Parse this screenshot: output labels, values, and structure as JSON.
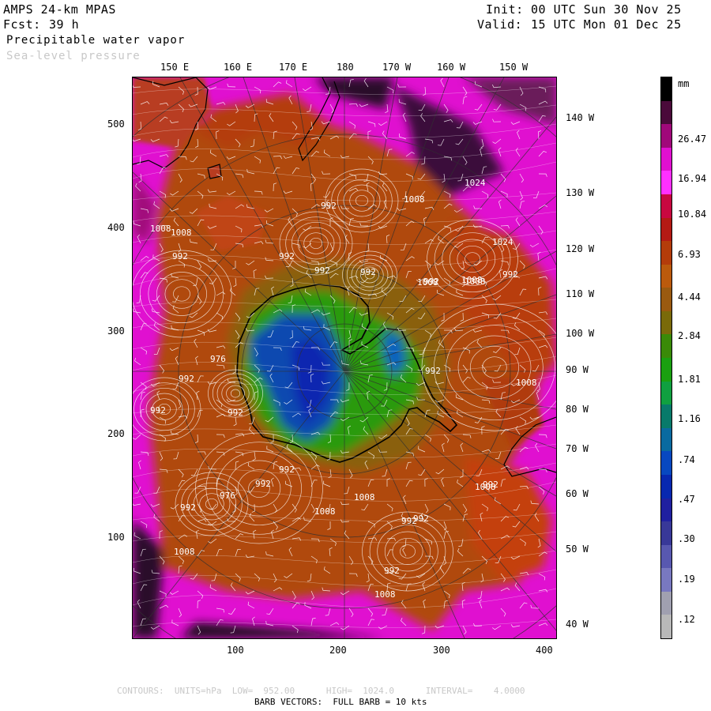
{
  "header": {
    "model": "AMPS 24-km MPAS",
    "fcst_label": "Fcst:",
    "fcst_hours": "39 h",
    "field1": "Precipitable water vapor",
    "field2": "Sea-level pressure",
    "init_label": "Init:",
    "init_time": "00 UTC Sun 30 Nov 25",
    "valid_label": "Valid:",
    "valid_time": "15 UTC Mon 01 Dec 25"
  },
  "top_longitudes": [
    "150 E",
    "160 E",
    "170 E",
    "180",
    "170 W",
    "160 W",
    "150 W"
  ],
  "right_longitudes": [
    "140 W",
    "130 W",
    "120 W",
    "110 W",
    "100 W",
    "90 W",
    "80 W",
    "70 W",
    "60 W",
    "50 W",
    "40 W"
  ],
  "y_axis_ticks": [
    "500",
    "400",
    "300",
    "200",
    "100"
  ],
  "x_axis_ticks": [
    "100",
    "200",
    "300",
    "400"
  ],
  "colorbar": {
    "unit": "mm",
    "labels": [
      "26.47",
      "16.94",
      "10.84",
      "6.93",
      "4.44",
      "2.84",
      "1.81",
      "1.16",
      ".74",
      ".47",
      ".30",
      ".19",
      ".12"
    ],
    "colors": [
      "#000000",
      "#4a0a3a",
      "#a0087a",
      "#e010d0",
      "#ff30ff",
      "#c80840",
      "#b41a14",
      "#b43c0a",
      "#bb5a0c",
      "#9a5a10",
      "#7a6a0a",
      "#3a8a08",
      "#1aa010",
      "#10a040",
      "#087a6a",
      "#0a6aa0",
      "#0848c0",
      "#0828b0",
      "#2020a0",
      "#383898",
      "#5858b0",
      "#7878c0",
      "#a0a0b0",
      "#b8b8b8"
    ]
  },
  "pressure_labels": [
    "1024",
    "1008",
    "992",
    "992",
    "1008",
    "992",
    "992",
    "992",
    "992",
    "976",
    "992",
    "992",
    "992",
    "992",
    "1008",
    "1008",
    "1008",
    "992",
    "1024",
    "1008",
    "992",
    "992",
    "976",
    "992",
    "992",
    "1008",
    "992",
    "1008",
    "1008",
    "992",
    "1008",
    "992",
    "1008",
    "1008"
  ],
  "footer": {
    "contours": "CONTOURS:  UNITS=hPa  LOW=  952.00      HIGH=  1024.0      INTERVAL=    4.0000",
    "barbs": "BARB VECTORS:  FULL BARB = 10 kts"
  }
}
